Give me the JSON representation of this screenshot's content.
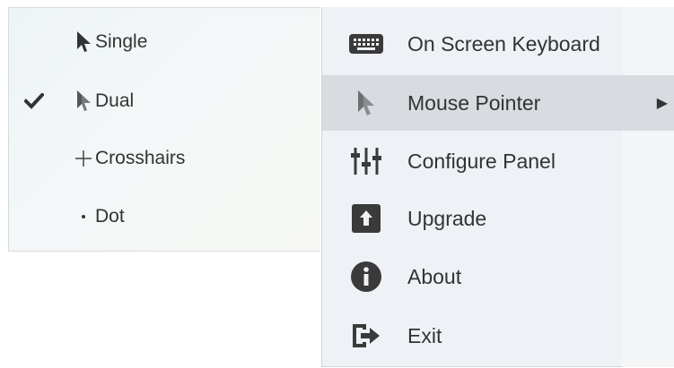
{
  "pointer_submenu": {
    "items": [
      {
        "label": "Single",
        "checked": false,
        "icon": "arrow-cursor-icon"
      },
      {
        "label": "Dual",
        "checked": true,
        "icon": "dual-arrow-cursor-icon"
      },
      {
        "label": "Crosshairs",
        "checked": false,
        "icon": "crosshair-icon"
      },
      {
        "label": "Dot",
        "checked": false,
        "icon": "dot-icon"
      }
    ]
  },
  "main_menu": {
    "items": [
      {
        "label": "On Screen Keyboard",
        "icon": "keyboard-icon"
      },
      {
        "label": "Mouse Pointer",
        "icon": "mouse-pointer-icon",
        "has_submenu": true,
        "highlighted": true
      },
      {
        "label": "Configure Panel",
        "icon": "sliders-icon"
      },
      {
        "label": "Upgrade",
        "icon": "upgrade-icon"
      },
      {
        "label": "About",
        "icon": "info-icon"
      },
      {
        "label": "Exit",
        "icon": "exit-icon"
      }
    ],
    "submenu_arrow": "▶"
  },
  "colors": {
    "highlight": "#d8dbdf",
    "icon_dark": "#3a3a3a",
    "menu_bg": "#eef1f5"
  }
}
